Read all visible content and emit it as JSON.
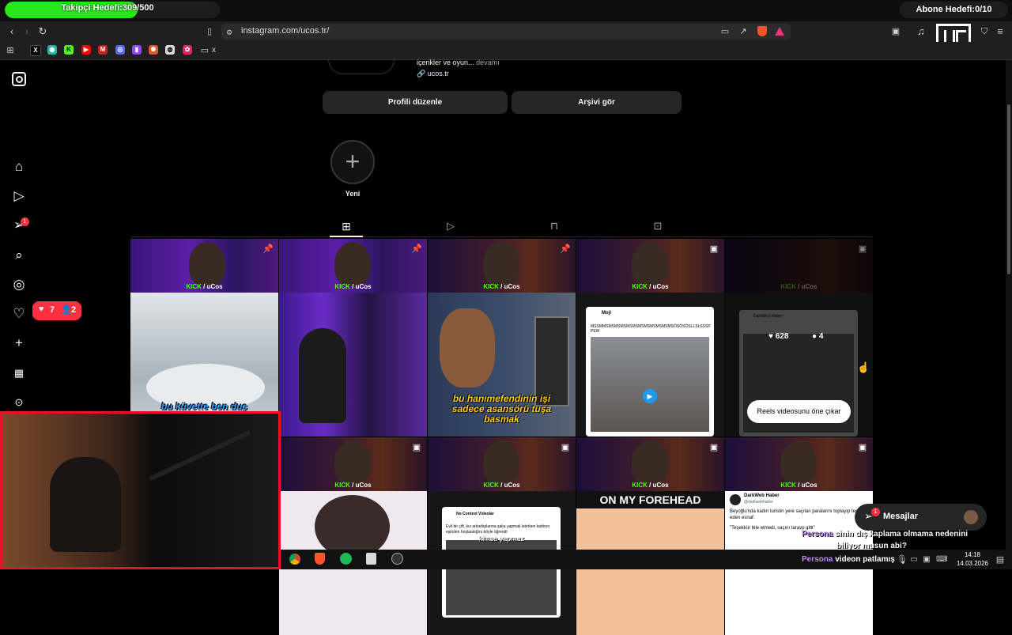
{
  "overlay": {
    "follower_goal": "Takipçi Hedefi:309/500",
    "follower_progress": 0.618,
    "sub_goal": "Abone Hedefi:0/10"
  },
  "browser": {
    "url": "instagram.com/ucos.tr/",
    "bookmark_folder": "x"
  },
  "profile": {
    "bio_tail": "içenkler ve oyun...",
    "more": "devamı",
    "link": "ucos.tr",
    "edit_button": "Profili düzenle",
    "archive_button": "Arşivi gör",
    "new_highlight": "Yeni"
  },
  "notifications": {
    "likes": "7",
    "follows": "2",
    "messages_badge": "1"
  },
  "grid": {
    "kick_caption_brand": "KICK",
    "kick_caption_name": "/ uCos",
    "tile1_sub": "bu küvette ben duş",
    "tile3_sub": "bu hanımefendinin işi sadece asansörü tuşa basmak",
    "tile4_tweet_text": "MSSMMSMSMSMSMSMSMSMSMSMSMSMSÖSÖSÖSLLSLSSSPPEW",
    "tile4_tweet_user": "Moji",
    "tile5_likes": "628",
    "tile5_comments": "4",
    "tile5_button": "Reels videosunu öne çıkar",
    "tile5_source": "DarkWeb Haber",
    "tile7_user": "No Context Videolar",
    "tile7_text": "Evli bir çift, kız arkadaşlarına şaka yapmak isterken kadının eşinden hoşlandığını böyle öğrendi",
    "tile7_sub": "kimse yapmaz",
    "tile8_caption": "ON MY FOREHEAD",
    "tile9_source": "DarkWeb Haber",
    "tile9_handle": "@darkwebhaber",
    "tile9_text1": "Beyoğlu'nda kadın turistin yere saçılan paralarını toplayıp teslim eden esnaf:",
    "tile9_text2": "\"Teşekkür bile etmedi, saçını taravp gitti\""
  },
  "messages": {
    "label": "Mesajlar"
  },
  "chat": {
    "line1_user": "Persona",
    "line1_text": "sinin dış kaplama olmama nedenini",
    "line2_text": "biliyor musun abi?",
    "line3_user": "Persona",
    "line3_text": "videon patlamış"
  },
  "taskbar": {
    "time": "14:18",
    "date": "14.03.2026"
  },
  "colors": {
    "kick_green": "#53fc18",
    "goal_green": "#29e61a",
    "notif_red": "#ff3040",
    "brand_orange": "#fb542b"
  }
}
